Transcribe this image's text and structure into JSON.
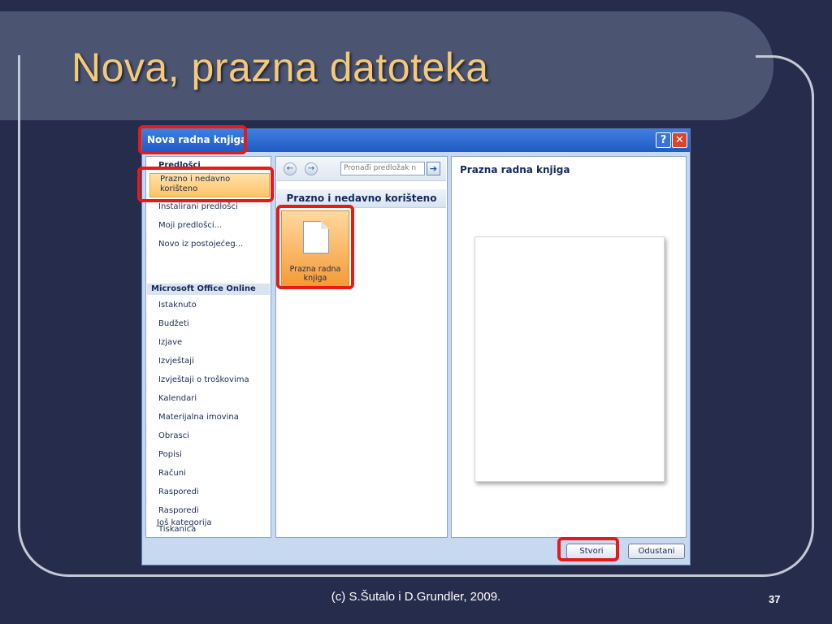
{
  "slide": {
    "title": "Nova, prazna datoteka",
    "footer": "(c) S.Šutalo i D.Grundler, 2009.",
    "page_number": "37"
  },
  "dialog": {
    "title": "Nova radna knjiga",
    "help_label": "?",
    "close_label": "✕",
    "left_panel": {
      "templates_heading": "Predlošci",
      "selected_item": "Prazno i nedavno korišteno",
      "items_top": [
        "Instalirani predlošci",
        "Moji predlošci...",
        "Novo iz postojećeg..."
      ],
      "online_heading": "Microsoft Office Online",
      "items_online": [
        "Istaknuto",
        "Budžeti",
        "Izjave",
        "Izvještaji",
        "Izvještaji o troškovima",
        "Kalendari",
        "Materijalna imovina",
        "Obrasci",
        "Popisi",
        "Računi",
        "Rasporedi",
        "Rasporedi",
        "Tiskanica",
        "Još kategorija"
      ]
    },
    "middle_panel": {
      "back_icon": "←",
      "forward_icon": "→",
      "search_placeholder": "Pronađi predložak n",
      "search_go_icon": "➔",
      "header": "Prazno i nedavno korišteno",
      "tile_label": "Prazna radna knjiga"
    },
    "right_panel": {
      "title": "Prazna radna knjiga"
    },
    "buttons": {
      "create": "Stvori",
      "cancel": "Odustani"
    }
  },
  "colors": {
    "background": "#262c4c",
    "title_color": "#f5c97a",
    "highlight": "#e51a1a",
    "selection": "#ffc36a"
  }
}
